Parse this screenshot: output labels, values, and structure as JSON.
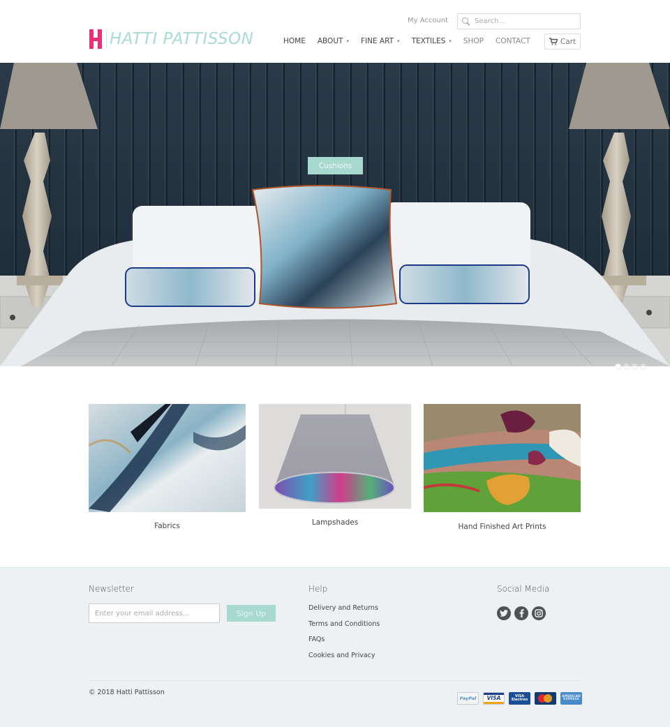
{
  "header": {
    "logo_text": "HATTI PATTISSON",
    "my_account": "My Account",
    "search_placeholder": "Search...",
    "cart_label": "Cart",
    "nav": [
      {
        "label": "HOME",
        "dropdown": false
      },
      {
        "label": "ABOUT",
        "dropdown": true
      },
      {
        "label": "FINE ART",
        "dropdown": true
      },
      {
        "label": "TEXTILES",
        "dropdown": true
      },
      {
        "label": "SHOP",
        "dropdown": false
      },
      {
        "label": "CONTACT",
        "dropdown": false
      }
    ],
    "caret": "▾"
  },
  "hero": {
    "cta_label": "Cushions",
    "slides": 4,
    "active_slide": 1
  },
  "collections": [
    {
      "label": "Fabrics"
    },
    {
      "label": "Lampshades"
    },
    {
      "label": "Hand Finished Art Prints"
    }
  ],
  "footer": {
    "newsletter": {
      "heading": "Newsletter",
      "email_placeholder": "Enter your email address...",
      "signup_label": "Sign Up"
    },
    "help": {
      "heading": "Help",
      "links": [
        "Delivery and Returns",
        "Terms and Conditions",
        "FAQs",
        "Cookies and Privacy"
      ]
    },
    "social": {
      "heading": "Social Media",
      "icons": [
        {
          "name": "twitter-icon",
          "glyph": "t"
        },
        {
          "name": "facebook-icon",
          "glyph": "f"
        },
        {
          "name": "instagram-icon",
          "glyph": "◙"
        }
      ]
    },
    "copyright": "© 2018 Hatti Pattisson",
    "payments": [
      {
        "name": "PayPal",
        "text": "PayPal"
      },
      {
        "name": "Visa",
        "text": "VISA"
      },
      {
        "name": "Visa Electron",
        "text": "VISA\nElectron"
      },
      {
        "name": "MasterCard",
        "text": ""
      },
      {
        "name": "American Express",
        "text": "AMERICAN\nEXPRESS"
      }
    ]
  },
  "colors": {
    "brand_pink": "#e8317a",
    "brand_mint": "#a7d9cf",
    "footer_bg": "#edf1f3"
  }
}
